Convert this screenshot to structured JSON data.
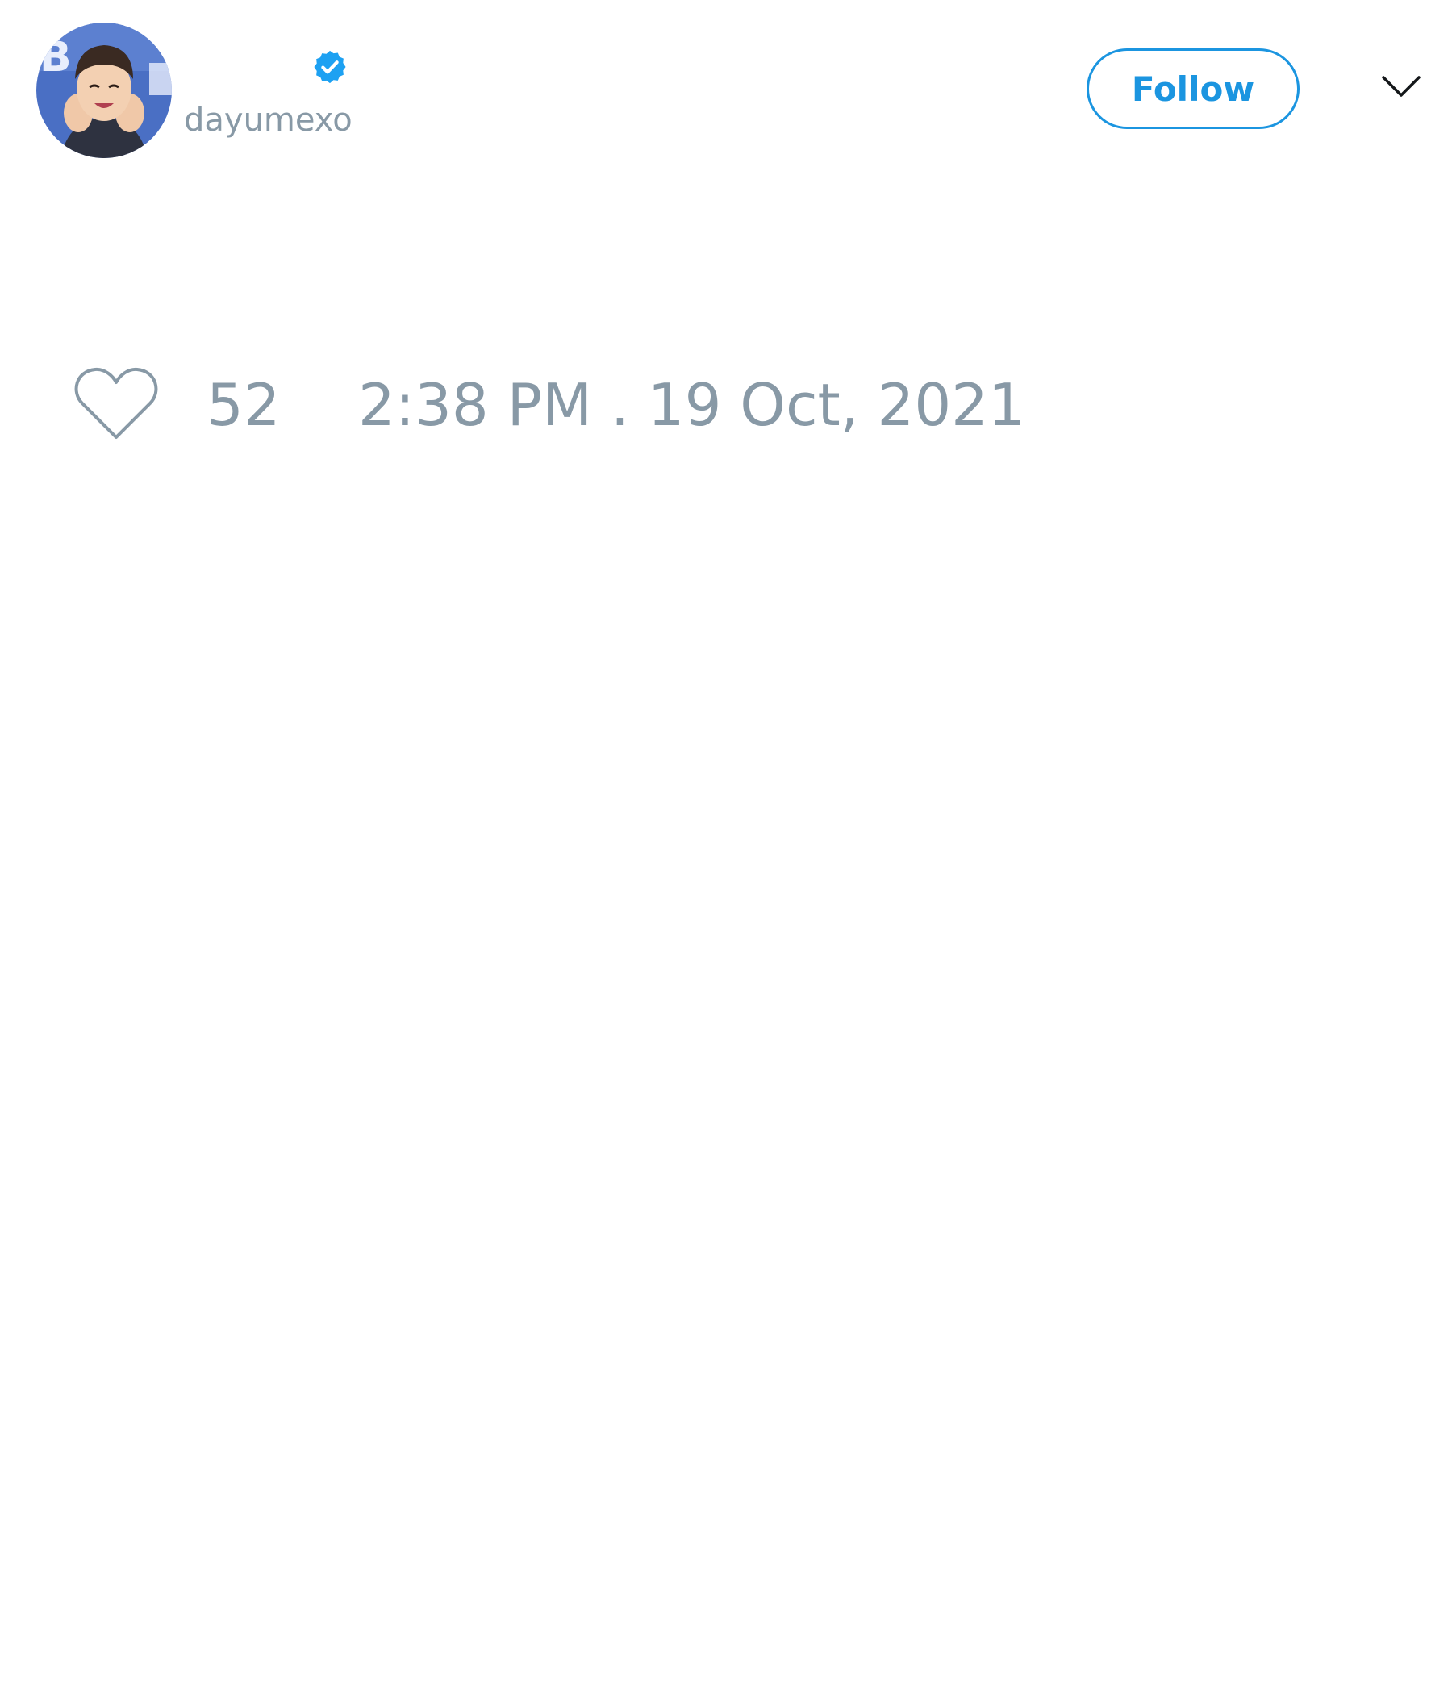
{
  "tweet": {
    "author": {
      "display_name": "",
      "handle": "dayumexo",
      "verified": true,
      "avatar_icon": "avatar-photo"
    },
    "follow_label": "Follow",
    "menu_icon": "chevron-down-icon",
    "like_icon": "heart-icon",
    "like_count": "52",
    "timestamp": "2:38 PM . 19 Oct, 2021"
  },
  "colors": {
    "accent": "#1b95e0",
    "verified": "#1da1f2",
    "muted_text": "#8899a6",
    "background": "#ffffff"
  }
}
